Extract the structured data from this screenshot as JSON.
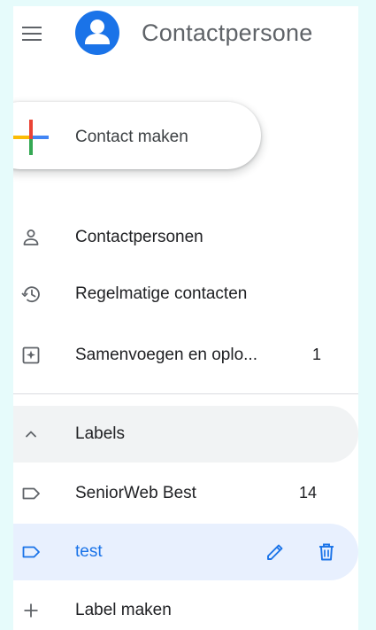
{
  "header": {
    "menu_icon": "hamburger-menu-icon",
    "app_title": "Contactpersone"
  },
  "create": {
    "label": "Contact maken",
    "icon": "multicolor-plus-icon",
    "colors": [
      "#ea4335",
      "#4285f4",
      "#34a853",
      "#fbbc04"
    ]
  },
  "nav": {
    "items": [
      {
        "label": "Contactpersonen",
        "icon": "person-icon"
      },
      {
        "label": "Regelmatige contacten",
        "icon": "history-icon"
      },
      {
        "label": "Samenvoegen en oplo...",
        "count": "1",
        "icon": "merge-fix-icon"
      }
    ]
  },
  "labels": {
    "header": "Labels",
    "header_icon": "chevron-up-icon",
    "items": [
      {
        "label": "SeniorWeb Best",
        "count": "14",
        "icon": "label-icon"
      },
      {
        "label": "test",
        "icon": "label-icon",
        "selected": true
      }
    ],
    "create_label": "Label maken",
    "create_icon": "plus-icon"
  },
  "colors": {
    "accent": "#1a73e8",
    "selected_bg": "#e8f0fe",
    "hover_bg": "#f1f3f4",
    "page_bg_stripes": "#e6fbfb"
  }
}
